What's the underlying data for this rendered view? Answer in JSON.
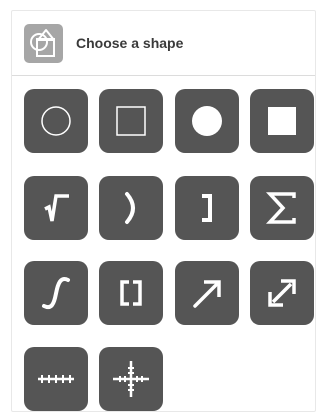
{
  "header": {
    "icon": "shapes-icon",
    "title": "Choose a shape"
  },
  "shapes": [
    {
      "name": "circle-outline",
      "icon": "circle-outline-icon"
    },
    {
      "name": "square-outline",
      "icon": "square-outline-icon"
    },
    {
      "name": "circle-filled",
      "icon": "circle-filled-icon"
    },
    {
      "name": "square-filled",
      "icon": "square-filled-icon"
    },
    {
      "name": "square-root",
      "icon": "square-root-icon"
    },
    {
      "name": "parenthesis",
      "icon": "parenthesis-icon"
    },
    {
      "name": "bracket",
      "icon": "bracket-icon"
    },
    {
      "name": "sigma",
      "icon": "sigma-icon"
    },
    {
      "name": "integral",
      "icon": "integral-icon"
    },
    {
      "name": "square-brackets",
      "icon": "square-brackets-icon"
    },
    {
      "name": "arrow",
      "icon": "arrow-icon"
    },
    {
      "name": "double-arrow",
      "icon": "double-arrow-icon"
    },
    {
      "name": "number-line",
      "icon": "number-line-icon"
    },
    {
      "name": "axes",
      "icon": "axes-icon"
    }
  ],
  "colors": {
    "tile": "#555555",
    "glyph": "#ffffff",
    "header_icon": "#a6a6a6"
  }
}
